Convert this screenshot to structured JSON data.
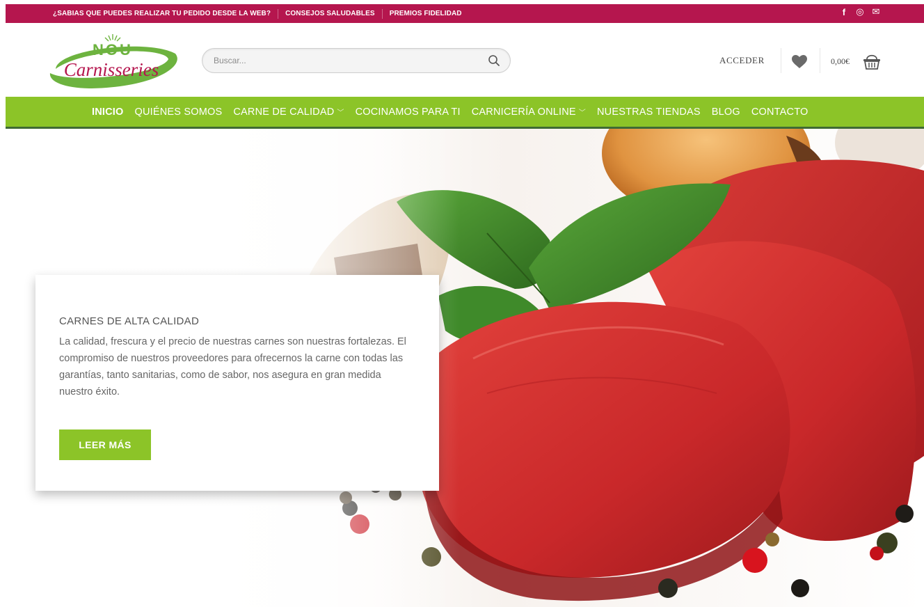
{
  "topbar": {
    "links": [
      {
        "label": "¿SABIAS QUE PUEDES REALIZAR TU PEDIDO DESDE LA WEB?"
      },
      {
        "label": "CONSEJOS SALUDABLES"
      },
      {
        "label": "PREMIOS FIDELIDAD"
      }
    ],
    "social": [
      {
        "icon": "facebook-icon",
        "glyph": "f"
      },
      {
        "icon": "instagram-icon",
        "glyph": "◎"
      },
      {
        "icon": "email-icon",
        "glyph": "✉"
      }
    ]
  },
  "header": {
    "logo": {
      "top": "NOU",
      "bottom": "Carnisseries"
    },
    "search": {
      "placeholder": "Buscar..."
    },
    "account": "ACCEDER",
    "cart_total": "0,00€"
  },
  "nav": {
    "items": [
      {
        "label": "INICIO",
        "active": true,
        "dropdown": false
      },
      {
        "label": "QUIÉNES SOMOS",
        "active": false,
        "dropdown": false
      },
      {
        "label": "CARNE DE CALIDAD",
        "active": false,
        "dropdown": true
      },
      {
        "label": "COCINAMOS PARA TI",
        "active": false,
        "dropdown": false
      },
      {
        "label": "CARNICERÍA ONLINE",
        "active": false,
        "dropdown": true
      },
      {
        "label": "NUESTRAS TIENDAS",
        "active": false,
        "dropdown": false
      },
      {
        "label": "BLOG",
        "active": false,
        "dropdown": false
      },
      {
        "label": "CONTACTO",
        "active": false,
        "dropdown": false
      }
    ]
  },
  "hero": {
    "eyebrow": "CARNES DE ALTA CALIDAD",
    "body": "La calidad, frescura y el precio de nuestras carnes son nuestras fortalezas. El compromiso de nuestros proveedores para ofrecernos la carne con todas las garantías, tanto sanitarias, como de sabor, nos asegura en gran medida nuestro éxito.",
    "button": "LEER MÁS"
  },
  "colors": {
    "topbar": "#b5164e",
    "nav": "#8cc428",
    "nav_border": "#3f6a34",
    "logo_green": "#6db33f",
    "logo_magenta": "#b5164e"
  }
}
